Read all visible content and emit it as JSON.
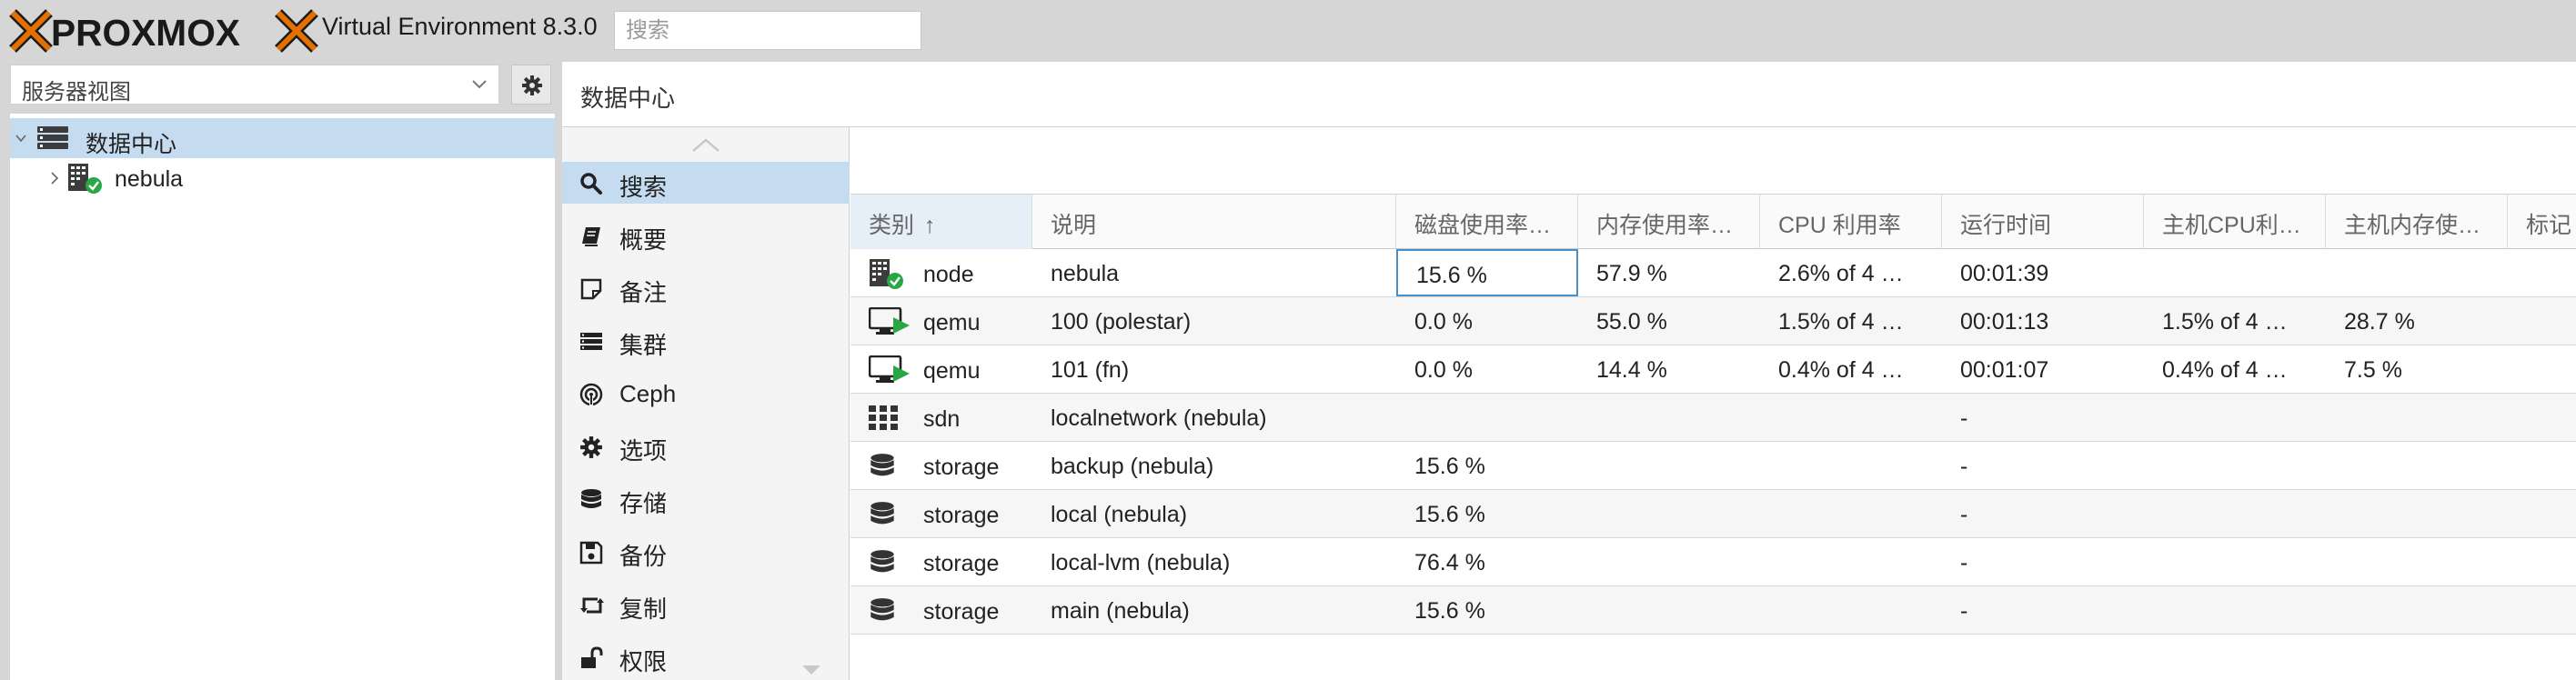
{
  "header": {
    "brand": "PROXMOX",
    "version": "Virtual Environment 8.3.0",
    "search_placeholder": "搜索"
  },
  "left": {
    "view_select": "服务器视图",
    "tree": [
      {
        "label": "数据中心",
        "selected": true
      },
      {
        "label": "nebula",
        "selected": false
      }
    ]
  },
  "content": {
    "breadcrumb": "数据中心",
    "menu": [
      {
        "label": "搜索",
        "icon": "search-icon",
        "selected": true
      },
      {
        "label": "概要",
        "icon": "book-icon"
      },
      {
        "label": "备注",
        "icon": "note-icon"
      },
      {
        "label": "集群",
        "icon": "server-icon"
      },
      {
        "label": "Ceph",
        "icon": "ceph-icon"
      },
      {
        "label": "选项",
        "icon": "gear-icon"
      },
      {
        "label": "存储",
        "icon": "database-icon"
      },
      {
        "label": "备份",
        "icon": "floppy-icon"
      },
      {
        "label": "复制",
        "icon": "retweet-icon"
      },
      {
        "label": "权限",
        "icon": "unlock-icon"
      }
    ],
    "grid": {
      "columns": [
        "类别",
        "说明",
        "磁盘使用率…",
        "内存使用率…",
        "CPU 利用率",
        "运行时间",
        "主机CPU利…",
        "主机内存使…",
        "标记"
      ],
      "sort_indicator": "↑",
      "rows": [
        {
          "type": "node",
          "icon": "node-online-icon",
          "desc": "nebula",
          "disk": "15.6 %",
          "mem": "57.9 %",
          "cpu": "2.6% of 4 …",
          "uptime": "00:01:39",
          "hostcpu": "",
          "hostmem": ""
        },
        {
          "type": "qemu",
          "icon": "vm-running-icon",
          "desc": "100 (polestar)",
          "disk": "0.0 %",
          "mem": "55.0 %",
          "cpu": "1.5% of 4 …",
          "uptime": "00:01:13",
          "hostcpu": "1.5% of 4 …",
          "hostmem": "28.7 %"
        },
        {
          "type": "qemu",
          "icon": "vm-running-icon",
          "desc": "101 (fn)",
          "disk": "0.0 %",
          "mem": "14.4 %",
          "cpu": "0.4% of 4 …",
          "uptime": "00:01:07",
          "hostcpu": "0.4% of 4 …",
          "hostmem": "7.5 %"
        },
        {
          "type": "sdn",
          "icon": "sdn-grid-icon",
          "desc": "localnetwork (nebula)",
          "disk": "",
          "mem": "",
          "cpu": "",
          "uptime": "-",
          "hostcpu": "",
          "hostmem": ""
        },
        {
          "type": "storage",
          "icon": "database-icon",
          "desc": "backup (nebula)",
          "disk": "15.6 %",
          "mem": "",
          "cpu": "",
          "uptime": "-",
          "hostcpu": "",
          "hostmem": ""
        },
        {
          "type": "storage",
          "icon": "database-icon",
          "desc": "local (nebula)",
          "disk": "15.6 %",
          "mem": "",
          "cpu": "",
          "uptime": "-",
          "hostcpu": "",
          "hostmem": ""
        },
        {
          "type": "storage",
          "icon": "database-icon",
          "desc": "local-lvm (nebula)",
          "disk": "76.4 %",
          "mem": "",
          "cpu": "",
          "uptime": "-",
          "hostcpu": "",
          "hostmem": ""
        },
        {
          "type": "storage",
          "icon": "database-icon",
          "desc": "main (nebula)",
          "disk": "15.6 %",
          "mem": "",
          "cpu": "",
          "uptime": "-",
          "hostcpu": "",
          "hostmem": ""
        }
      ]
    }
  },
  "colors": {
    "brand_orange": "#e57000",
    "selection_blue": "#c5dcf0",
    "status_green": "#28a745"
  }
}
